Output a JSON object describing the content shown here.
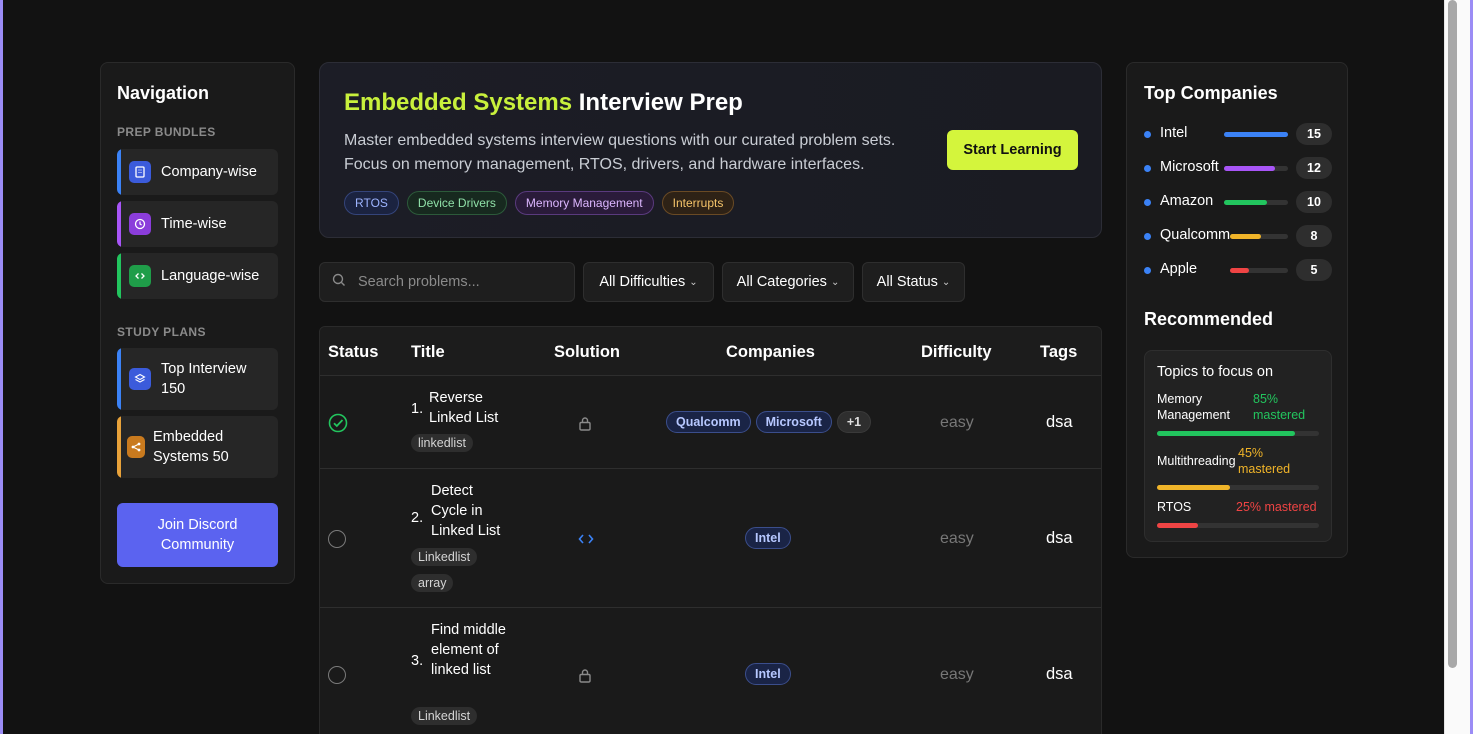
{
  "navigation": {
    "title": "Navigation",
    "prep_section": "PREP BUNDLES",
    "prep_items": [
      {
        "label": "Company-wise",
        "icon": "building-icon",
        "color": "#3b82f6"
      },
      {
        "label": "Time-wise",
        "icon": "clock-icon",
        "color": "#a855f7"
      },
      {
        "label": "Language-wise",
        "icon": "code-icon",
        "color": "#22c55e"
      }
    ],
    "study_section": "STUDY PLANS",
    "study_items": [
      {
        "label": "Top Interview 150",
        "icon": "layers-icon",
        "color": "#3b82f6"
      },
      {
        "label": "Embedded Systems 50",
        "icon": "share-icon",
        "color": "#e8a23a"
      }
    ],
    "discord_label": "Join Discord Community"
  },
  "hero": {
    "title_accent": "Embedded Systems",
    "title_rest": " Interview Prep",
    "description": "Master embedded systems interview questions with our curated problem sets. Focus on memory management, RTOS, drivers, and hardware interfaces.",
    "cta": "Start Learning",
    "tags": [
      "RTOS",
      "Device Drivers",
      "Memory Management",
      "Interrupts"
    ]
  },
  "filters": {
    "search_placeholder": "Search problems...",
    "difficulty": "All Difficulties",
    "category": "All Categories",
    "status": "All Status"
  },
  "table": {
    "headers": [
      "Status",
      "Title",
      "Solution",
      "Companies",
      "Difficulty",
      "Tags"
    ],
    "rows": [
      {
        "num": "1.",
        "title": "Reverse Linked List",
        "tags": [
          "linkedlist"
        ],
        "status": "solved",
        "solution": "locked",
        "companies": [
          "Qualcomm",
          "Microsoft",
          "+1"
        ],
        "difficulty": "easy",
        "tag_text": "dsa"
      },
      {
        "num": "2.",
        "title": "Detect Cycle in Linked List",
        "tags": [
          "Linkedlist",
          "array"
        ],
        "status": "unsolved",
        "solution": "code",
        "companies": [
          "Intel"
        ],
        "difficulty": "easy",
        "tag_text": "dsa"
      },
      {
        "num": "3.",
        "title": "Find middle element of linked list",
        "tags": [
          "Linkedlist"
        ],
        "status": "unsolved",
        "solution": "locked",
        "companies": [
          "Intel"
        ],
        "difficulty": "easy",
        "tag_text": "dsa"
      }
    ]
  },
  "top_companies": {
    "title": "Top Companies",
    "items": [
      {
        "name": "Intel",
        "count": "15",
        "fill": 1.0,
        "color": "#3b82f6"
      },
      {
        "name": "Microsoft",
        "count": "12",
        "fill": 0.8,
        "color": "#a855f7"
      },
      {
        "name": "Amazon",
        "count": "10",
        "fill": 0.67,
        "color": "#22c55e"
      },
      {
        "name": "Qualcomm",
        "count": "8",
        "fill": 0.53,
        "color": "#f0b429"
      },
      {
        "name": "Apple",
        "count": "5",
        "fill": 0.33,
        "color": "#ef4444"
      }
    ]
  },
  "recommended": {
    "title": "Recommended",
    "heading": "Topics to focus on",
    "topics": [
      {
        "name": "Memory Management",
        "pct": "85% mastered",
        "fill": 0.85,
        "color": "#22c55e"
      },
      {
        "name": "Multithreading",
        "pct": "45% mastered",
        "fill": 0.45,
        "color": "#f0b429"
      },
      {
        "name": "RTOS",
        "pct": "25% mastered",
        "fill": 0.25,
        "color": "#ef4444"
      }
    ]
  }
}
